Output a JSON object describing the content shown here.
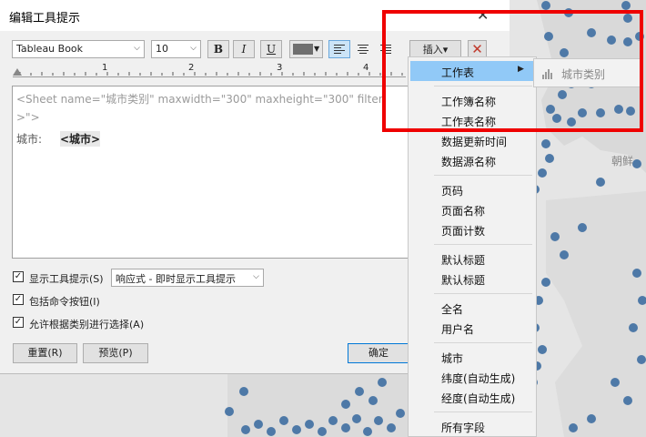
{
  "dialog": {
    "title": "编辑工具提示",
    "font_family_value": "Tableau Book",
    "font_size_value": "10",
    "insert_button_label": "插入▾",
    "ruler_marks": [
      "1",
      "2",
      "3",
      "4"
    ],
    "editor": {
      "line1": "<Sheet name=\"城市类别\" maxwidth=\"300\" maxheight=\"300\" filter",
      "line2": ">\">",
      "line3_label": "城市:",
      "line3_field": "<城市>"
    },
    "options": {
      "show_tooltip": "显示工具提示(S)",
      "tooltip_mode": "响应式 - 即时显示工具提示",
      "include_buttons": "包括命令按钮(I)",
      "allow_select": "允许根据类别进行选择(A)"
    },
    "buttons": {
      "reset": "重置(R)",
      "preview": "预览(P)",
      "ok": "确定"
    }
  },
  "insert_menu": {
    "groups": [
      [
        "工作表"
      ],
      [
        "工作簿名称",
        "工作表名称",
        "数据更新时间",
        "数据源名称"
      ],
      [
        "页码",
        "页面名称",
        "页面计数"
      ],
      [
        "默认标题",
        "默认标题"
      ],
      [
        "全名",
        "用户名"
      ],
      [
        "城市",
        "纬度(自动生成)",
        "经度(自动生成)"
      ],
      [
        "所有字段"
      ]
    ],
    "submenu_item": "城市类别"
  },
  "map": {
    "label": "朝鲜",
    "dot_color": "#4e79a7"
  },
  "colors": {
    "highlight_box": "#ef0000",
    "menu_highlight": "#91c9f7"
  }
}
